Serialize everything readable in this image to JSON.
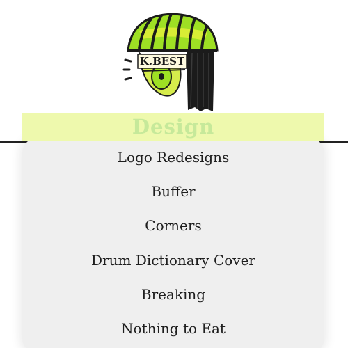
{
  "logo": {
    "text": "K.BEST",
    "icon": "k-best-logo-icon",
    "colors": {
      "lime": "#9ee024",
      "dark": "#1b1b1b",
      "yellow": "#e6f03a"
    }
  },
  "header": {
    "title": "Design",
    "band_color": "#eef9ad",
    "title_color": "#c6e99a"
  },
  "menu": {
    "items": [
      {
        "label": "Logo Redesigns"
      },
      {
        "label": "Buffer"
      },
      {
        "label": "Corners"
      },
      {
        "label": "Drum Dictionary Cover"
      },
      {
        "label": "Breaking"
      },
      {
        "label": "Nothing to Eat"
      }
    ]
  }
}
